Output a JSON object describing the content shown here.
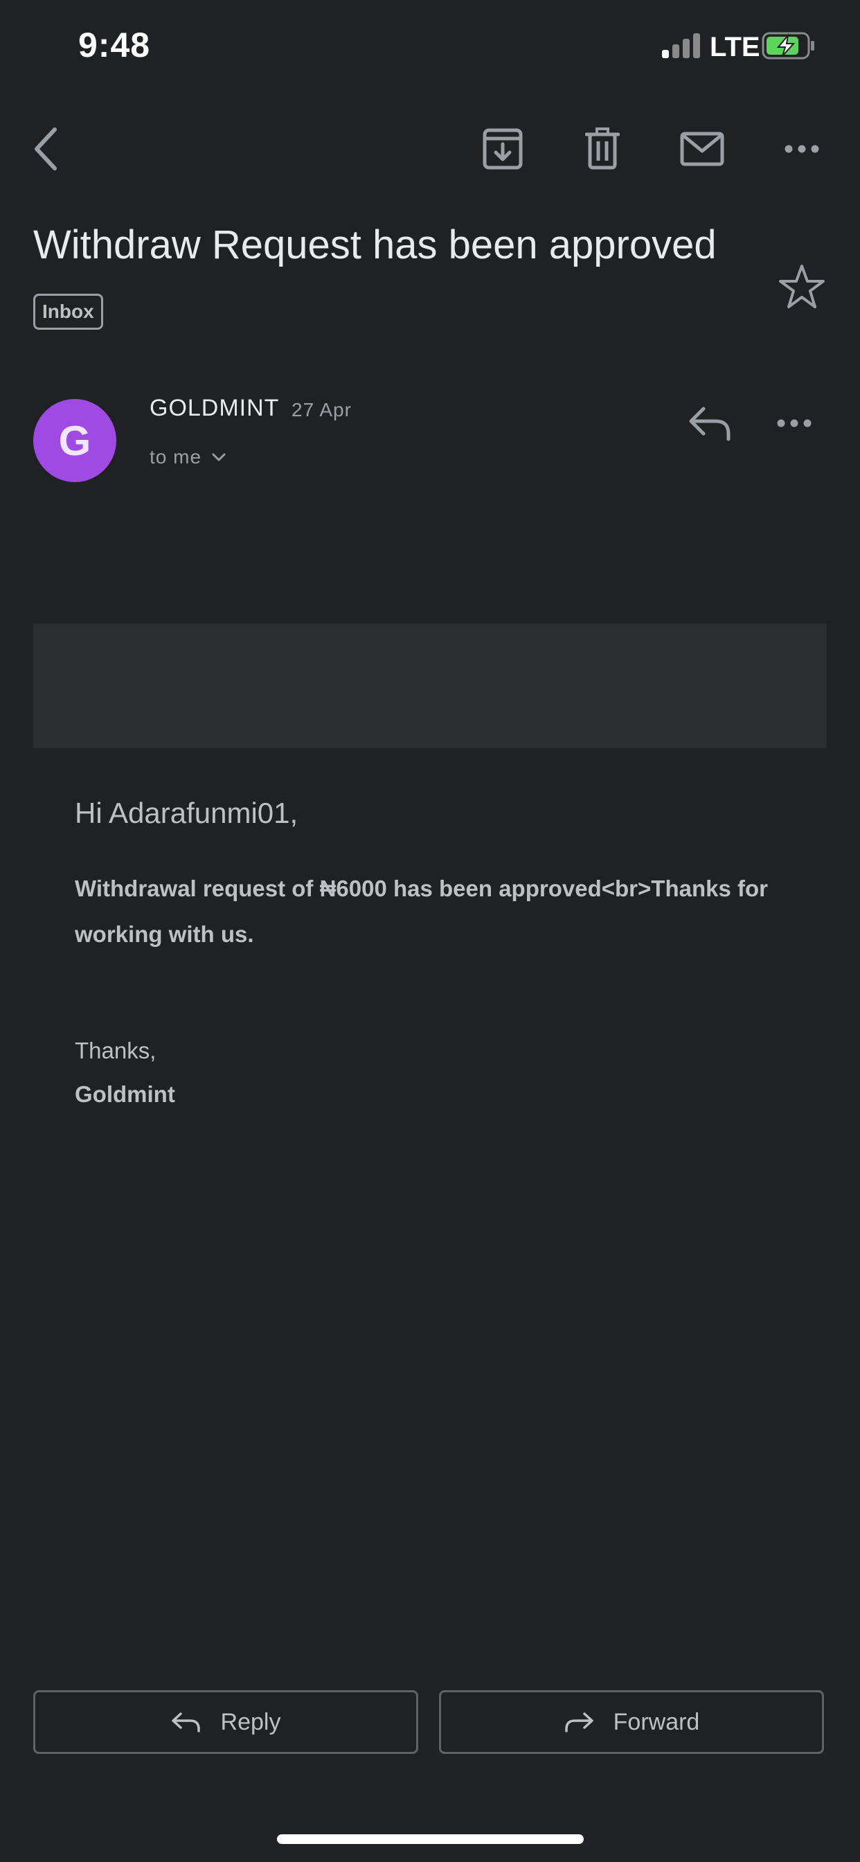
{
  "status_bar": {
    "time": "9:48",
    "network": "LTE"
  },
  "toolbar": {
    "back_icon": "chevron-left-icon",
    "archive_icon": "archive-icon",
    "delete_icon": "trash-icon",
    "mark_unread_icon": "mail-icon",
    "more_icon": "more-horizontal-icon"
  },
  "email": {
    "subject": "Withdraw Request has been approved",
    "label": "Inbox",
    "starred": false,
    "sender": {
      "initial": "G",
      "name": "GOLDMINT",
      "date": "27 Apr",
      "recipient": "to me",
      "avatar_color": "#9e4ae3"
    },
    "body": {
      "greeting": "Hi Adarafunmi01,",
      "message": "Withdrawal request of ₦6000 has been approved<br>Thanks for working with us.",
      "signoff": "Thanks,",
      "signature": "Goldmint"
    }
  },
  "actions": {
    "reply_label": "Reply",
    "forward_label": "Forward"
  },
  "colors": {
    "background": "#202124",
    "banner": "#2c2d30",
    "text_primary": "#e8eaed",
    "text_secondary": "#bdc1c6",
    "battery_charging": "#5dd55d"
  }
}
